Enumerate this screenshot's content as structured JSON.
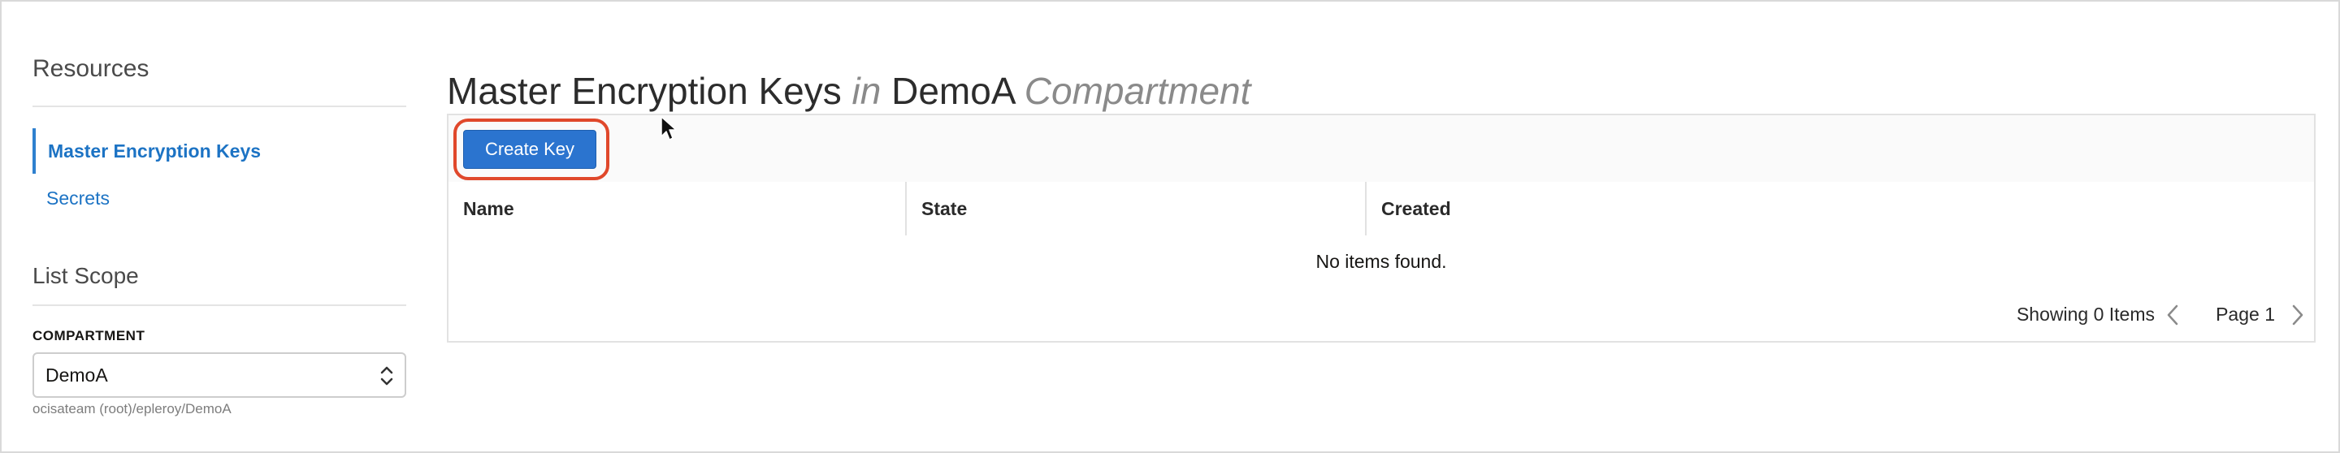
{
  "sidebar": {
    "resources_heading": "Resources",
    "items": [
      {
        "label": "Master Encryption Keys",
        "active": true
      },
      {
        "label": "Secrets",
        "active": false
      }
    ],
    "list_scope_heading": "List Scope",
    "compartment_label": "COMPARTMENT",
    "compartment_value": "DemoA",
    "compartment_path": "ocisateam (root)/epleroy/DemoA"
  },
  "header": {
    "title_main": "Master Encryption Keys",
    "title_in": "in",
    "title_compartment": "DemoA",
    "title_suffix": "Compartment"
  },
  "toolbar": {
    "create_key_label": "Create Key"
  },
  "table": {
    "columns": [
      "Name",
      "State",
      "Created"
    ],
    "empty_message": "No items found."
  },
  "footer": {
    "showing_text": "Showing 0 Items",
    "page_text": "Page 1"
  },
  "colors": {
    "accent": "#2b74cf",
    "link": "#1c73c4",
    "highlight": "#e0482b"
  },
  "icons": {
    "select_chevron": "chevron-up-down-icon",
    "prev": "chevron-left-icon",
    "next": "chevron-right-icon",
    "cursor": "mouse-pointer-icon"
  }
}
